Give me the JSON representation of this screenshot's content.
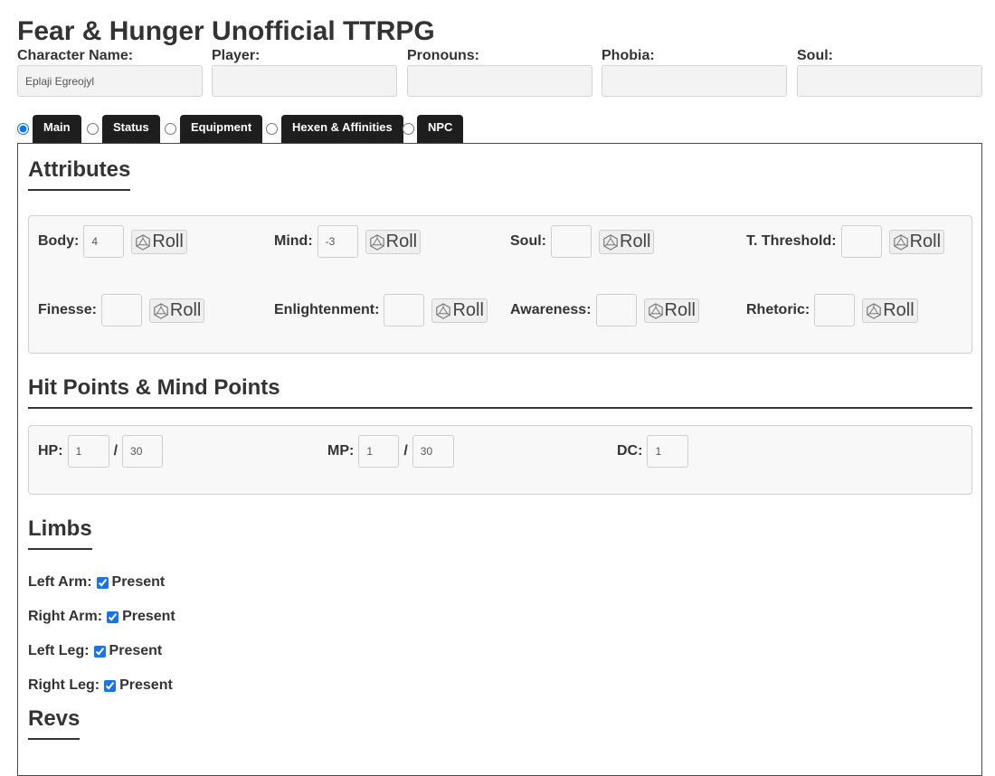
{
  "title": "Fear & Hunger Unofficial TTRPG",
  "header": {
    "character_name": {
      "label": "Character Name:",
      "value": "Eplaji Egreojyl"
    },
    "player": {
      "label": "Player:",
      "value": ""
    },
    "pronouns": {
      "label": "Pronouns:",
      "value": ""
    },
    "phobia": {
      "label": "Phobia:",
      "value": ""
    },
    "soul": {
      "label": "Soul:",
      "value": ""
    }
  },
  "tabs": [
    {
      "label": "Main",
      "selected": true
    },
    {
      "label": "Status",
      "selected": false
    },
    {
      "label": "Equipment",
      "selected": false
    },
    {
      "label": "Hexen & Affinities",
      "selected": false
    },
    {
      "label": "NPC",
      "selected": false
    }
  ],
  "attributes": {
    "title": "Attributes",
    "roll_label": "Roll",
    "roll_icon": "d20-die-icon",
    "items": [
      {
        "label": "Body:",
        "value": "4"
      },
      {
        "label": "Mind:",
        "value": "-3"
      },
      {
        "label": "Soul:",
        "value": ""
      },
      {
        "label": "T. Threshold:",
        "value": ""
      },
      {
        "label": "Finesse:",
        "value": ""
      },
      {
        "label": "Enlightenment:",
        "value": ""
      },
      {
        "label": "Awareness:",
        "value": ""
      },
      {
        "label": "Rhetoric:",
        "value": ""
      }
    ]
  },
  "points": {
    "title": "Hit Points & Mind Points",
    "hp": {
      "label": "HP:",
      "current": "1",
      "max": "30"
    },
    "mp": {
      "label": "MP:",
      "current": "1",
      "max": "30"
    },
    "dc": {
      "label": "DC:",
      "value": "1"
    },
    "separator": "/"
  },
  "limbs": {
    "title": "Limbs",
    "present_label": "Present",
    "items": [
      {
        "label": "Left Arm:",
        "checked": true
      },
      {
        "label": "Right Arm:",
        "checked": true
      },
      {
        "label": "Left Leg:",
        "checked": true
      },
      {
        "label": "Right Leg:",
        "checked": true
      }
    ]
  },
  "revs": {
    "title": "Revs"
  }
}
